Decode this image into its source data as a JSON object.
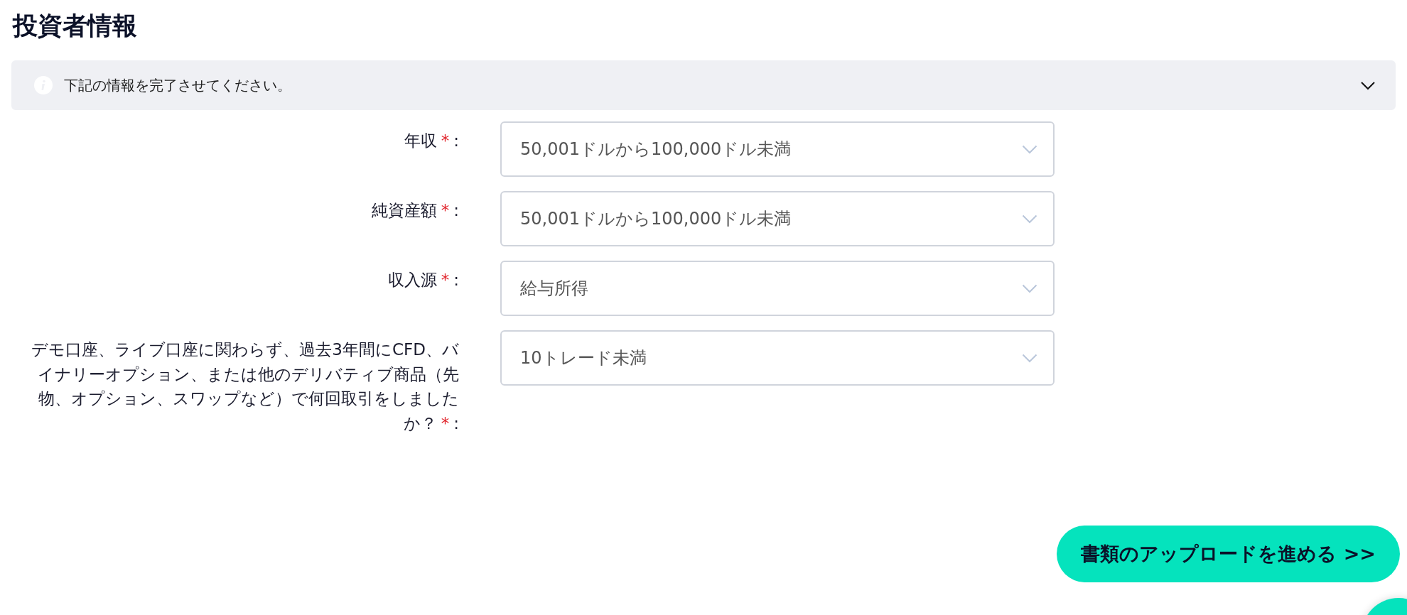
{
  "title": "投資者情報",
  "notice": {
    "text": "下記の情報を完了させてください。",
    "expanded": false
  },
  "fields": [
    {
      "label": "年収",
      "required_mark": "*",
      "suffix": ":",
      "value": "50,001ドルから100,000ドル未満"
    },
    {
      "label": "純資産額",
      "required_mark": "*",
      "suffix": ":",
      "value": "50,001ドルから100,000ドル未満"
    },
    {
      "label": "収入源",
      "required_mark": "*",
      "suffix": ":",
      "value": "給与所得"
    },
    {
      "label": "デモ口座、ライブ口座に関わらず、過去3年間にCFD、バイナリーオプション、または他のデリバティブ商品（先物、オプション、スワップなど）で何回取引をしましたか？",
      "required_mark": "*",
      "suffix": ":",
      "value": "10トレード未満"
    }
  ],
  "submit_button": "書類のアップロードを進める >>"
}
